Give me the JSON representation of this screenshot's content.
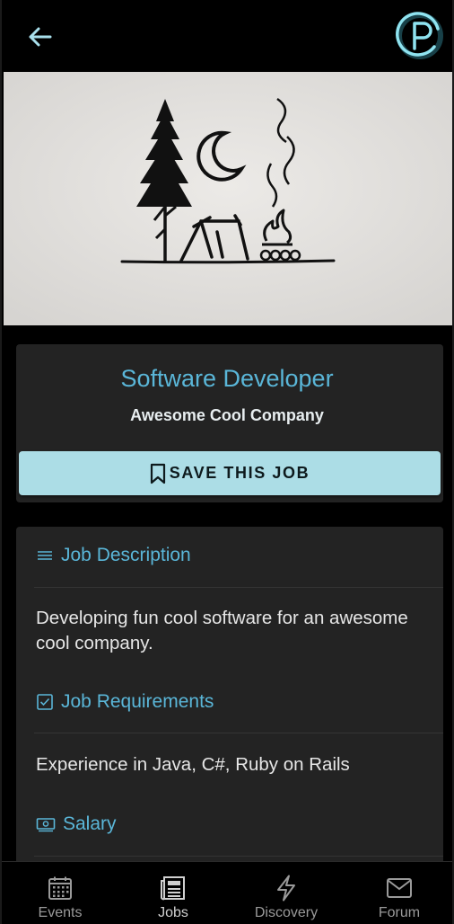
{
  "topbar": {
    "back_icon": "arrow-left-icon",
    "logo_letter": "P",
    "logo_color": "#7fd6e8"
  },
  "hero": {
    "description_icon": "camping-sketch"
  },
  "job": {
    "title": "Software Developer",
    "company": "Awesome Cool Company",
    "save_label": "SAVE THIS JOB"
  },
  "sections": {
    "description": {
      "heading": "Job Description",
      "icon": "lines-icon",
      "text": "Developing fun cool software for an awesome cool company."
    },
    "requirements": {
      "heading": "Job Requirements",
      "icon": "checkbox-icon",
      "text": "Experience in Java, C#, Ruby on Rails"
    },
    "salary": {
      "heading": "Salary",
      "icon": "money-icon"
    }
  },
  "nav": {
    "items": [
      {
        "label": "Events",
        "icon": "calendar-icon"
      },
      {
        "label": "Jobs",
        "icon": "newspaper-icon"
      },
      {
        "label": "Discovery",
        "icon": "lightning-icon"
      },
      {
        "label": "Forum",
        "icon": "mail-icon"
      }
    ],
    "active": "Jobs"
  },
  "colors": {
    "accent": "#5ab6d8",
    "button_bg": "#acdde6",
    "card_bg": "#232323",
    "background": "#000000"
  }
}
